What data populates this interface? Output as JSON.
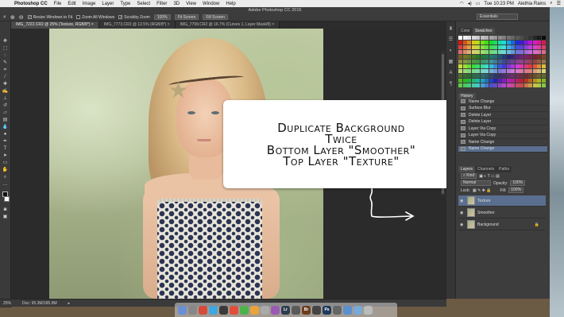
{
  "menubar": {
    "app": "Photoshop CC",
    "items": [
      "File",
      "Edit",
      "Image",
      "Layer",
      "Type",
      "Select",
      "Filter",
      "3D",
      "View",
      "Window",
      "Help"
    ],
    "clock": "Tue 10:23 PM",
    "user": "Alethia Rains"
  },
  "options_bar": {
    "app_title": "Adobe Photoshop CC 2015",
    "resize_windows": "Resize Windows to Fit",
    "zoom_all": "Zoom All Windows",
    "scrubby_zoom": "Scrubby Zoom",
    "zoom_value": "100%",
    "fit_screen": "Fit Screen",
    "fill_screen": "Fill Screen",
    "workspace": "Essentials"
  },
  "tabs": [
    "IMG_7222.CR2 @ 25% (Texture, RGB/8*) ×",
    "IMG_7773.CR2 @ 12.5% (RGB/8*) ×",
    "IMG_7799.CR2 @ 16.7% (Curves 1, Layer Mask/8) ×"
  ],
  "overlay": {
    "lines": [
      "Duplicate Background",
      "Twice",
      "Bottom Layer \"Smoother\"",
      "Top Layer \"Texture\""
    ]
  },
  "status": {
    "zoom": "25%",
    "doc": "Doc: 95.3M/185.8M"
  },
  "panels": {
    "color_tab": "Color",
    "swatches_tab": "Swatches",
    "history_title": "History",
    "history": [
      "Name Change",
      "Surface Blur",
      "Delete Layer",
      "Delete Layer",
      "Layer Via Copy",
      "Layer Via Copy",
      "Name Change",
      "Name Change"
    ],
    "layers_tabs": [
      "Layers",
      "Channels",
      "Paths"
    ],
    "kind": "Kind",
    "blend_mode": "Normal",
    "opacity_label": "Opacity:",
    "opacity": "100%",
    "lock_label": "Lock:",
    "fill_label": "Fill:",
    "fill": "100%",
    "layers": [
      "Texture",
      "Smoother",
      "Background"
    ]
  },
  "dock_labels": [
    "Lr",
    "Br",
    "Ps"
  ]
}
